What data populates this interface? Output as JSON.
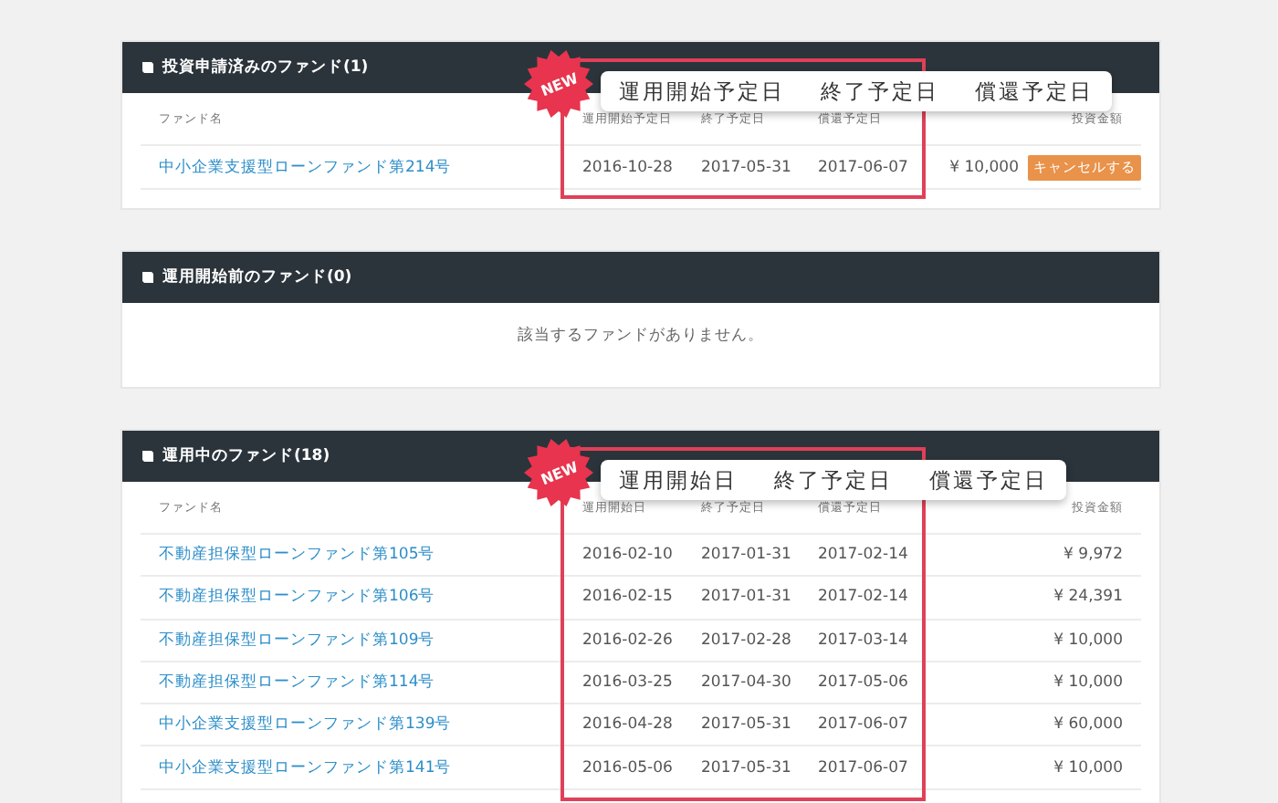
{
  "sections": [
    {
      "title": "投資申請済みのファンド(1)",
      "columns": [
        "ファンド名",
        "運用開始予定日",
        "終了予定日",
        "償還予定日",
        "投資金額"
      ],
      "rows": [
        {
          "fund": "中小企業支援型ローンファンド第214号",
          "start": "2016-10-28",
          "end": "2017-05-31",
          "redemption": "2017-06-07",
          "amount": "¥ 10,000",
          "action": "キャンセルする"
        }
      ],
      "annotation": {
        "badge": "NEW",
        "labels": [
          "運用開始予定日",
          "終了予定日",
          "償還予定日"
        ]
      }
    },
    {
      "title": "運用開始前のファンド(0)",
      "empty_message": "該当するファンドがありません。"
    },
    {
      "title": "運用中のファンド(18)",
      "columns": [
        "ファンド名",
        "運用開始日",
        "終了予定日",
        "償還予定日",
        "投資金額"
      ],
      "rows": [
        {
          "fund": "不動産担保型ローンファンド第105号",
          "start": "2016-02-10",
          "end": "2017-01-31",
          "redemption": "2017-02-14",
          "amount": "¥ 9,972"
        },
        {
          "fund": "不動産担保型ローンファンド第106号",
          "start": "2016-02-15",
          "end": "2017-01-31",
          "redemption": "2017-02-14",
          "amount": "¥ 24,391"
        },
        {
          "fund": "不動産担保型ローンファンド第109号",
          "start": "2016-02-26",
          "end": "2017-02-28",
          "redemption": "2017-03-14",
          "amount": "¥ 10,000"
        },
        {
          "fund": "不動産担保型ローンファンド第114号",
          "start": "2016-03-25",
          "end": "2017-04-30",
          "redemption": "2017-05-06",
          "amount": "¥ 10,000"
        },
        {
          "fund": "中小企業支援型ローンファンド第139号",
          "start": "2016-04-28",
          "end": "2017-05-31",
          "redemption": "2017-06-07",
          "amount": "¥ 60,000"
        },
        {
          "fund": "中小企業支援型ローンファンド第141号",
          "start": "2016-05-06",
          "end": "2017-05-31",
          "redemption": "2017-06-07",
          "amount": "¥ 10,000"
        }
      ],
      "annotation": {
        "badge": "NEW",
        "labels": [
          "運用開始日",
          "終了予定日",
          "償還予定日"
        ]
      }
    }
  ]
}
